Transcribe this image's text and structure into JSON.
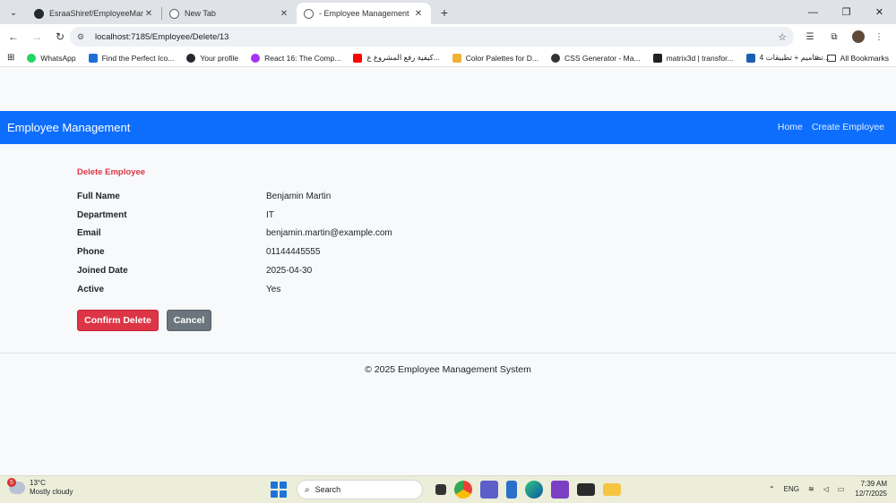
{
  "browser": {
    "tabs": [
      {
        "title": "EsraaShiref/EmployeeManagem",
        "close": "✕",
        "active": false,
        "color": "#24292f"
      },
      {
        "title": "New Tab",
        "close": "✕",
        "active": false,
        "color": "#5f6368"
      },
      {
        "title": "- Employee Management",
        "close": "✕",
        "active": true,
        "color": "#5f6368"
      }
    ],
    "new_tab": "+",
    "url": "localhost:7185/Employee/Delete/13",
    "bookmarks": [
      {
        "label": "WhatsApp",
        "color": "#25d366"
      },
      {
        "label": "Find the Perfect Ico...",
        "color": "#1d6fd6"
      },
      {
        "label": "Your profile",
        "color": "#24292f"
      },
      {
        "label": "React 16: The Comp...",
        "color": "#a435f0"
      },
      {
        "label": "كيفية رفع المشروع ع...",
        "color": "#ff0000"
      },
      {
        "label": "Color Palettes for D...",
        "color": "#f2b134"
      },
      {
        "label": "CSS Generator - Ma...",
        "color": "#333333"
      },
      {
        "label": "matrix3d | transfor...",
        "color": "#222222"
      },
      {
        "label": "4 تصاميم + تطبيقات...",
        "color": "#1a5fb4"
      }
    ],
    "all_bookmarks": "All Bookmarks"
  },
  "page": {
    "brand": "Employee Management",
    "nav": [
      "Home",
      "Create Employee"
    ],
    "heading": "Delete Employee",
    "details": [
      {
        "label": "Full Name",
        "value": "Benjamin Martin"
      },
      {
        "label": "Department",
        "value": "IT"
      },
      {
        "label": "Email",
        "value": "benjamin.martin@example.com"
      },
      {
        "label": "Phone",
        "value": "01144445555"
      },
      {
        "label": "Joined Date",
        "value": "2025-04-30"
      },
      {
        "label": "Active",
        "value": "Yes"
      }
    ],
    "confirm_label": "Confirm Delete",
    "cancel_label": "Cancel",
    "footer": "© 2025 Employee Management System",
    "colors": {
      "primary": "#0d6efd",
      "danger": "#dc3545",
      "secondary": "#6c757d"
    }
  },
  "taskbar": {
    "temperature": "13°C",
    "weather": "Mostly cloudy",
    "weather_badge": "5",
    "search_label": "Search",
    "language": "ENG",
    "time": "7:39 AM",
    "date": "12/7/2025"
  }
}
